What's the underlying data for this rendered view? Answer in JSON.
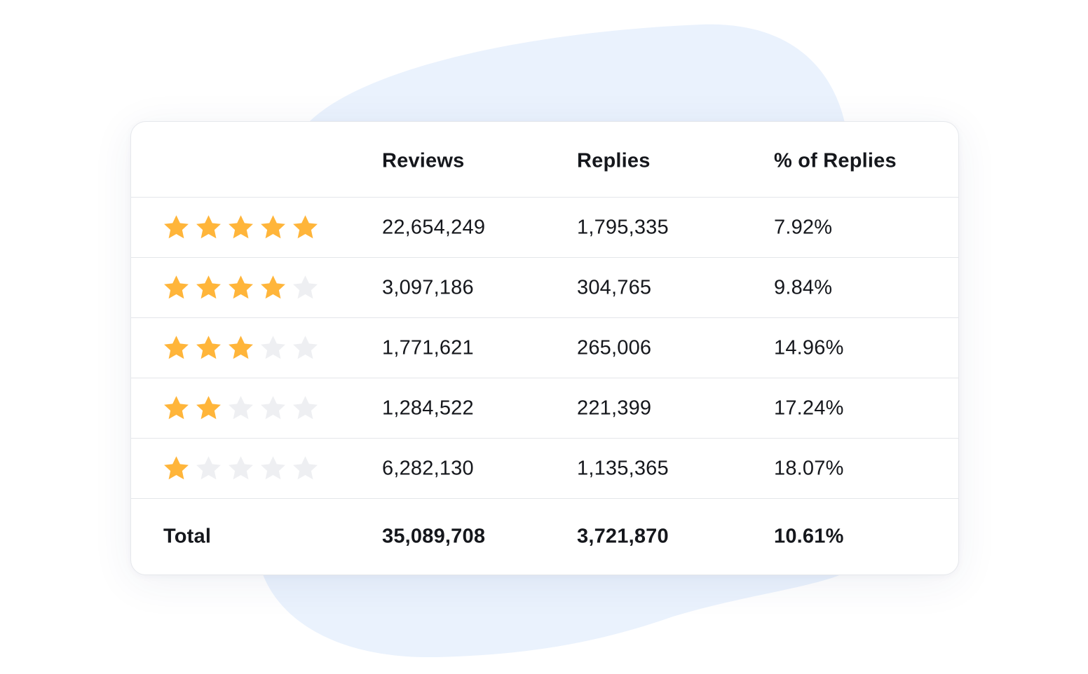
{
  "colors": {
    "star_filled": "#FFB53A",
    "star_empty": "#EEEFF2",
    "blob": "#EAF2FD",
    "text": "#15171C",
    "divider": "#E4E6EA"
  },
  "table": {
    "headers": {
      "label": "",
      "reviews": "Reviews",
      "replies": "Replies",
      "pct": "% of Replies"
    },
    "rows": [
      {
        "rating": 5,
        "reviews": "22,654,249",
        "replies": "1,795,335",
        "pct": "7.92%"
      },
      {
        "rating": 4,
        "reviews": "3,097,186",
        "replies": "304,765",
        "pct": "9.84%"
      },
      {
        "rating": 3,
        "reviews": "1,771,621",
        "replies": "265,006",
        "pct": "14.96%"
      },
      {
        "rating": 2,
        "reviews": "1,284,522",
        "replies": "221,399",
        "pct": "17.24%"
      },
      {
        "rating": 1,
        "reviews": "6,282,130",
        "replies": "1,135,365",
        "pct": "18.07%"
      }
    ],
    "total": {
      "label": "Total",
      "reviews": "35,089,708",
      "replies": "3,721,870",
      "pct": "10.61%"
    },
    "max_rating": 5
  }
}
